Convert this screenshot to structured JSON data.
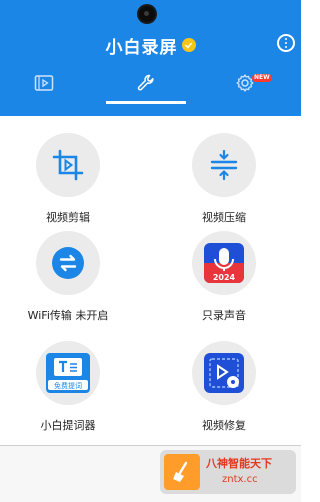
{
  "header": {
    "title": "小白录屏",
    "accent_color": "#1b86e6",
    "badge_color": "#f5c518"
  },
  "tabs": [
    {
      "icon": "video-file-icon",
      "active": false
    },
    {
      "icon": "wrench-icon",
      "active": true
    },
    {
      "icon": "settings-gear-icon",
      "active": false,
      "badge": "NEW"
    }
  ],
  "tools": [
    {
      "label": "视频剪辑",
      "icon": "crop-video-icon"
    },
    {
      "label": "视频压缩",
      "icon": "compress-icon"
    },
    {
      "label": "WiFi传输 未开启",
      "icon": "transfer-icon"
    },
    {
      "label": "只录声音",
      "icon": "microphone-icon",
      "icon_text": "2024"
    },
    {
      "label": "小白提词器",
      "icon": "teleprompter-icon",
      "icon_text": "免费提词"
    },
    {
      "label": "视频修复",
      "icon": "video-repair-icon"
    }
  ],
  "watermark": {
    "line1": "八神智能天下",
    "line2": "zntx.cc"
  }
}
